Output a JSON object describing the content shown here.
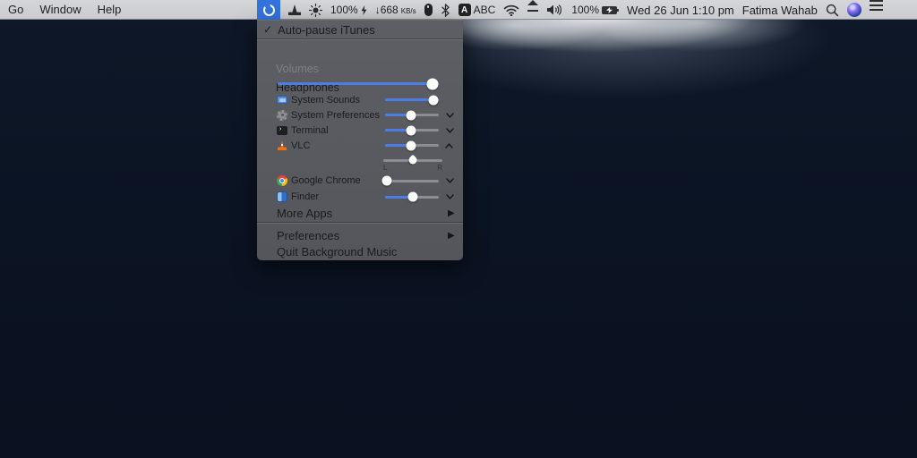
{
  "menubar": {
    "left_items": [
      {
        "label": "Go"
      },
      {
        "label": "Window"
      },
      {
        "label": "Help"
      }
    ],
    "status": {
      "bgm_battery_percent": "100%",
      "network_down": "↓668",
      "network_unit": "KB/s",
      "input_badge": "A",
      "input_label": "ABC",
      "volume_battery_percent": "100%",
      "clock": "Wed 26 Jun 1:10 pm",
      "user_name": "Fatima Wahab"
    }
  },
  "menu": {
    "auto_pause": {
      "checkmark": "✓",
      "label": "Auto-pause iTunes"
    },
    "volumes_header": "Volumes",
    "output_device": {
      "label": "Headphones",
      "volume_pct": 96
    },
    "apps": [
      {
        "name": "System Sounds",
        "icon": "system-sounds-icon",
        "volume_pct": 90,
        "chevron": "none"
      },
      {
        "name": "System Preferences",
        "icon": "system-preferences-icon",
        "volume_pct": 48,
        "chevron": "down"
      },
      {
        "name": "Terminal",
        "icon": "terminal-icon",
        "volume_pct": 48,
        "chevron": "down"
      },
      {
        "name": "VLC",
        "icon": "vlc-icon",
        "volume_pct": 48,
        "chevron": "up"
      }
    ],
    "pan": {
      "value_pct": 50,
      "left_label": "L",
      "right_label": "R"
    },
    "apps_secondary": [
      {
        "name": "Google Chrome",
        "icon": "chrome-icon",
        "volume_pct": 4,
        "chevron": "down"
      },
      {
        "name": "Finder",
        "icon": "finder-icon",
        "volume_pct": 52,
        "chevron": "down"
      }
    ],
    "more_apps_label": "More Apps",
    "submenu_arrow": "▶",
    "preferences_label": "Preferences",
    "quit_label": "Quit Background Music"
  },
  "colors": {
    "accent_blue": "#4a7de8",
    "slider_track_gray": "#8b8d92",
    "menu_background": "#57595e",
    "menubar_background": "#cdcfd2",
    "highlighted_icon_blue": "#3273dd",
    "vlc_orange": "#f07c1f"
  }
}
